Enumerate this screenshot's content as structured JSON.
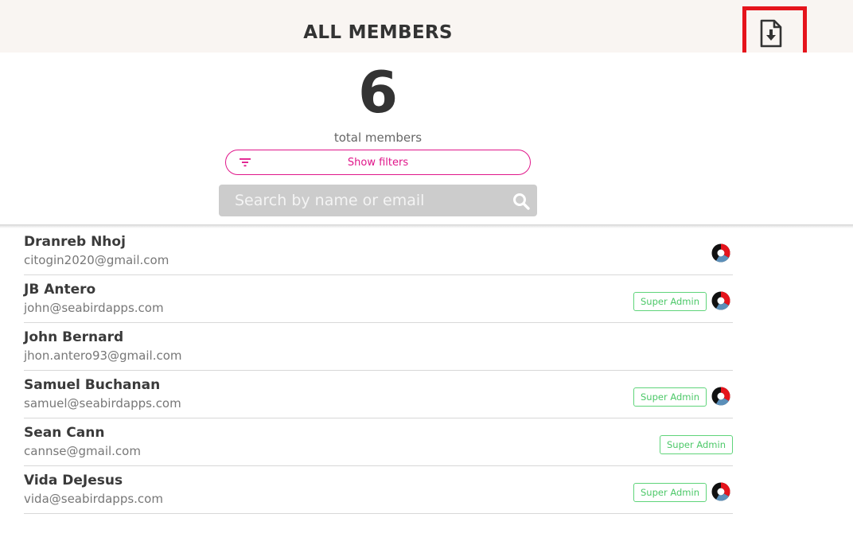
{
  "header": {
    "title": "ALL MEMBERS",
    "export_icon": "file-download-icon"
  },
  "summary": {
    "count": "6",
    "caption": "total members"
  },
  "filters": {
    "label": "Show filters",
    "icon": "filter-icon"
  },
  "search": {
    "placeholder": "Search by name or email",
    "value": "",
    "icon": "search-icon"
  },
  "colors": {
    "accent": "#e0168a",
    "badge_green": "#4cc868",
    "highlight_red": "#e5141c",
    "ring_colors": [
      "#e5141c",
      "#5b8fb9",
      "#111111"
    ]
  },
  "members": [
    {
      "name": "Dranreb Nhoj",
      "email": "citogin2020@gmail.com",
      "badge": "",
      "ring": true
    },
    {
      "name": "JB Antero",
      "email": "john@seabirdapps.com",
      "badge": "Super Admin",
      "ring": true
    },
    {
      "name": "John Bernard",
      "email": "jhon.antero93@gmail.com",
      "badge": "",
      "ring": false
    },
    {
      "name": "Samuel Buchanan",
      "email": "samuel@seabirdapps.com",
      "badge": "Super Admin",
      "ring": true
    },
    {
      "name": "Sean Cann",
      "email": "cannse@gmail.com",
      "badge": "Super Admin",
      "ring": false
    },
    {
      "name": "Vida DeJesus",
      "email": "vida@seabirdapps.com",
      "badge": "Super Admin",
      "ring": true
    }
  ]
}
